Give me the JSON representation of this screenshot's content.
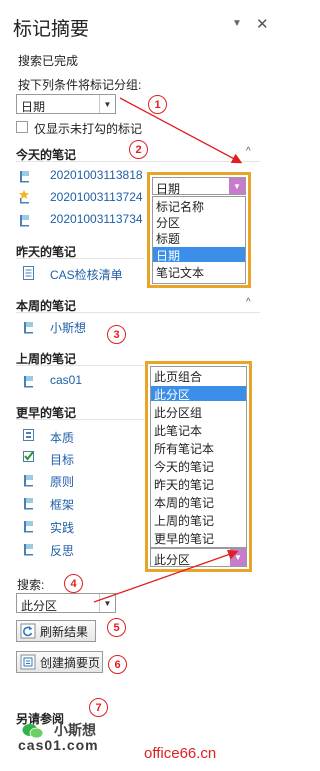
{
  "pane": {
    "title": "标记摘要",
    "dropdown_icon": "triangle-down",
    "close_icon": "close-x"
  },
  "status_text": "搜索已完成",
  "group_by": {
    "label": "按下列条件将标记分组:",
    "value": "日期"
  },
  "unchecked_only": {
    "label": "仅显示未打勾的标记",
    "checked": false
  },
  "sections": {
    "today": {
      "heading": "今天的笔记",
      "items": [
        "20201003113818",
        "20201003113724",
        "20201003113734"
      ]
    },
    "yesterday": {
      "heading": "昨天的笔记",
      "items": [
        "CAS检核清单"
      ]
    },
    "this_week": {
      "heading": "本周的笔记",
      "items": [
        "小斯想"
      ]
    },
    "last_week": {
      "heading": "上周的笔记",
      "items": [
        "cas01"
      ]
    },
    "earlier": {
      "heading": "更早的笔记",
      "items": [
        "本质",
        "目标",
        "原则",
        "框架",
        "实践",
        "反思"
      ]
    }
  },
  "group_popup": {
    "value": "日期",
    "options": [
      "标记名称",
      "分区",
      "标题",
      "日期",
      "笔记文本"
    ],
    "selected": "日期"
  },
  "search_popup": {
    "options": [
      "此页组合",
      "此分区",
      "此分区组",
      "此笔记本",
      "所有笔记本",
      "今天的笔记",
      "昨天的笔记",
      "本周的笔记",
      "上周的笔记",
      "更早的笔记"
    ],
    "selected": "此分区",
    "value": "此分区"
  },
  "search": {
    "label": "搜索:",
    "value": "此分区"
  },
  "buttons": {
    "refresh": "刷新结果",
    "create_summary": "创建摘要页"
  },
  "see_also": "另请参阅",
  "watermark": {
    "line1": "小斯想",
    "line2": "cas01.com",
    "site": "office66.cn"
  },
  "callouts": [
    "1",
    "2",
    "3",
    "4",
    "5",
    "6",
    "7"
  ],
  "colors": {
    "callout_red": "#e02020",
    "popup_border": "#e8a527",
    "selection_blue": "#3b8fe8",
    "link_blue": "#1f5fa8",
    "dropdown_accent": "#c77bcb"
  }
}
